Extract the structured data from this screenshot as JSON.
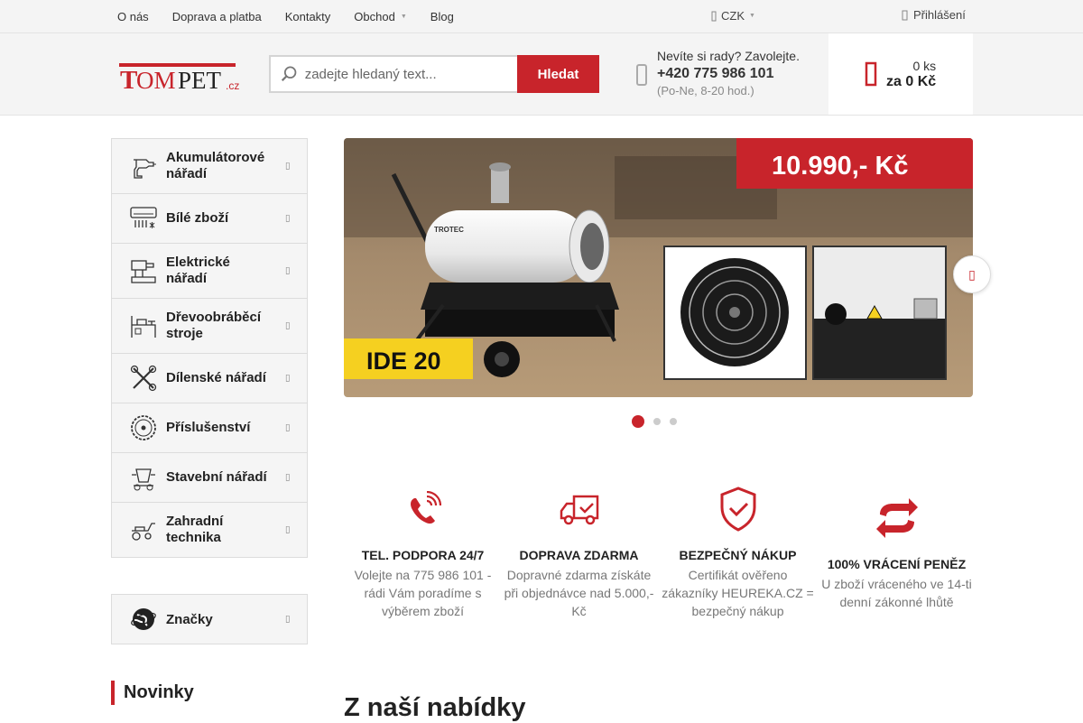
{
  "topnav": {
    "items": [
      "O nás",
      "Doprava a platba",
      "Kontakty",
      "Obchod",
      "Blog"
    ],
    "currency": "CZK",
    "login": "Přihlášení"
  },
  "header": {
    "logo_text": "TOMPET",
    "logo_suffix": ".cz",
    "search_placeholder": "zadejte hledaný text...",
    "search_button": "Hledat",
    "contact_question": "Nevíte si rady? Zavolejte.",
    "contact_phone": "+420 775 986 101",
    "contact_hours": "(Po-Ne, 8-20 hod.)",
    "cart_count": "0 ks",
    "cart_total": "za 0 Kč"
  },
  "sidebar": {
    "categories": [
      {
        "label": "Akumulátorové nářadí",
        "icon": "cordless-drill-icon"
      },
      {
        "label": "Bílé zboží",
        "icon": "air-conditioner-icon"
      },
      {
        "label": "Elektrické nářadí",
        "icon": "power-tool-icon"
      },
      {
        "label": "Dřevoobráběcí stroje",
        "icon": "woodworking-machine-icon"
      },
      {
        "label": "Dílenské nářadí",
        "icon": "wrenches-icon"
      },
      {
        "label": "Příslušenství",
        "icon": "saw-blade-icon"
      },
      {
        "label": "Stavební nářadí",
        "icon": "concrete-mixer-icon"
      },
      {
        "label": "Zahradní technika",
        "icon": "lawn-mower-icon"
      }
    ],
    "brands": "Značky",
    "news_title": "Novinky"
  },
  "banner": {
    "price": "10.990,- Kč",
    "model": "IDE 20",
    "brand_label": "TROTEC",
    "slides": 3,
    "active_slide": 1
  },
  "benefits": [
    {
      "title": "TEL. PODPORA 24/7",
      "desc": "Volejte na 775 986 101 - rádi Vám poradíme s výběrem zboží",
      "icon": "phone-icon"
    },
    {
      "title": "DOPRAVA ZDARMA",
      "desc": "Dopravné zdarma získáte při objednávce nad 5.000,- Kč",
      "icon": "delivery-truck-icon"
    },
    {
      "title": "BEZPEČNÝ NÁKUP",
      "desc": "Certifikát ověřeno zákazníky HEUREKA.CZ = bezpečný nákup",
      "icon": "shield-check-icon"
    },
    {
      "title": "100% VRÁCENÍ PENĚZ",
      "desc": "U zboží vráceného ve 14-ti denní zákonné lhůtě",
      "icon": "refund-arrows-icon"
    }
  ],
  "section_title": "Z naší nabídky",
  "colors": {
    "accent": "#c8242b",
    "topbar_bg": "#f4f4f4",
    "banner_yellow": "#f5d020"
  }
}
